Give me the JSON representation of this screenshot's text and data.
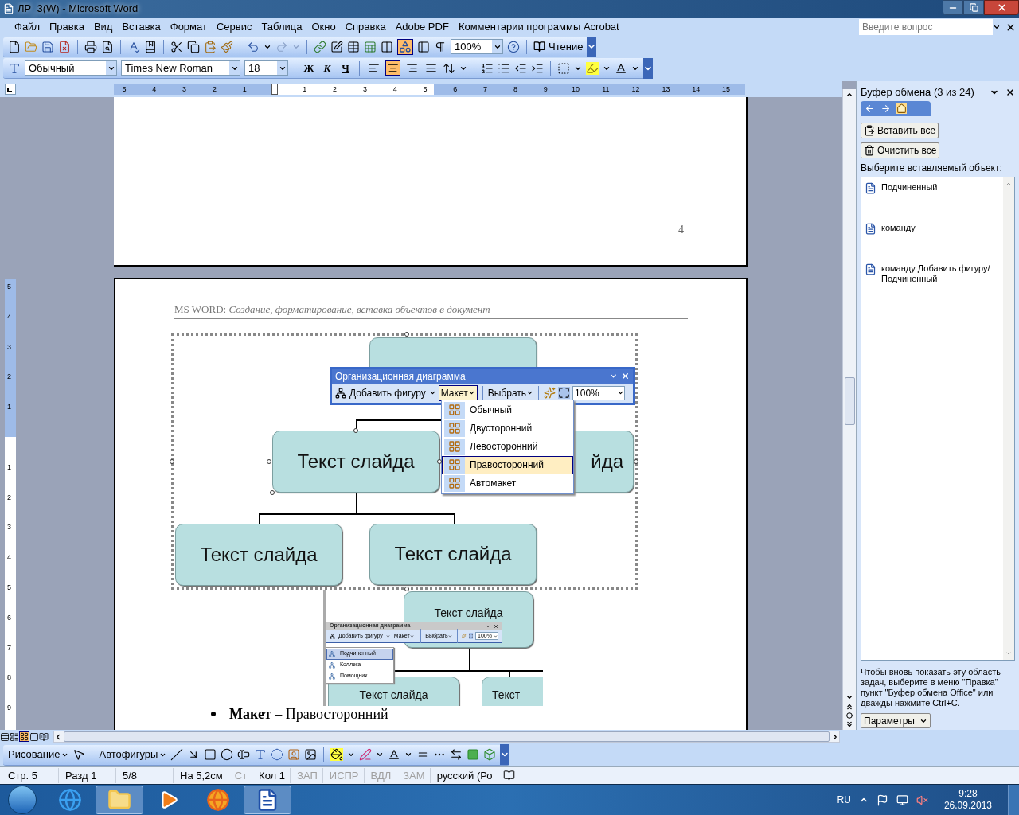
{
  "window": {
    "title": "ЛР_3(W) - Microsoft Word"
  },
  "menu": [
    {
      "label": "Файл"
    },
    {
      "label": "Правка"
    },
    {
      "label": "Вид"
    },
    {
      "label": "Вставка"
    },
    {
      "label": "Формат"
    },
    {
      "label": "Сервис"
    },
    {
      "label": "Таблица"
    },
    {
      "label": "Окно"
    },
    {
      "label": "Справка"
    },
    {
      "label": "Adobe PDF"
    },
    {
      "label": "Комментарии программы Acrobat"
    }
  ],
  "help_field": {
    "placeholder": "Введите вопрос"
  },
  "standard_toolbar": {
    "drawing_selected": true,
    "zoom": "100%",
    "reading": "Чтение"
  },
  "formatting_toolbar": {
    "style": "Обычный",
    "font": "Times New Roman",
    "size": "18",
    "text_buttons": [
      {
        "label": "Ж",
        "kind": "bold"
      },
      {
        "label": "К",
        "kind": "italic"
      },
      {
        "label": "Ч",
        "kind": "underline"
      }
    ],
    "alignment": [
      {
        "kind": "left",
        "selected": false
      },
      {
        "kind": "center",
        "selected": true
      },
      {
        "kind": "right",
        "selected": false
      },
      {
        "kind": "justify",
        "selected": false
      }
    ]
  },
  "horizontal_ruler": {
    "left_numbers": [
      "5",
      "4",
      "3",
      "2",
      "1"
    ],
    "right_numbers": [
      "1",
      "2",
      "3",
      "4",
      "5",
      "6",
      "7",
      "8",
      "9",
      "10",
      "11",
      "12",
      "13",
      "14",
      "15"
    ]
  },
  "vertical_ruler": {
    "top_numbers": [
      "5",
      "4",
      "3",
      "2",
      "1"
    ],
    "bottom_numbers": [
      "1",
      "2",
      "3",
      "4",
      "5",
      "6",
      "7",
      "8",
      "9"
    ]
  },
  "page_number": "4",
  "running_header": "MS WORD: *Создание, форматирование, вставка объектов в документ*",
  "org_chart": {
    "middle_left": "Текст слайда",
    "middle_right": "йда",
    "bottom": [
      "Текст слайда",
      "Текст слайда"
    ]
  },
  "org_toolbar": {
    "title": "Организационная диаграмма",
    "add_shape": "Добавить фигуру",
    "layout": "Макет",
    "select": "Выбрать",
    "zoom": "100%"
  },
  "layout_menu": [
    {
      "label": "Обычный",
      "selected": false
    },
    {
      "label": "Двусторонний",
      "selected": false
    },
    {
      "label": "Левосторонний",
      "selected": false
    },
    {
      "label": "Правосторонний",
      "selected": true
    },
    {
      "label": "Автомакет",
      "selected": false
    }
  ],
  "embedded_screenshot": {
    "top_node": "Текст слайда",
    "toolbar": {
      "title": "Организационная диаграмма",
      "add_shape": "Добавить фигуру",
      "layout": "Макет",
      "select": "Выбрать",
      "zoom": "100%"
    },
    "menu": [
      {
        "label": "Подчиненный",
        "selected": true
      },
      {
        "label": "Коллега",
        "selected": false
      },
      {
        "label": "Помощник",
        "selected": false
      }
    ],
    "bottom_nodes": [
      "Текст слайда",
      "Текст"
    ]
  },
  "bullet": "**Макет** – Правосторонний",
  "task_pane": {
    "title": "Буфер обмена (3 из 24)",
    "paste_all": "Вставить все",
    "clear_all": "Очистить все",
    "prompt": "Выберите вставляемый объект:",
    "items": [
      "Подчиненный",
      "команду",
      "команду Добавить фигуру/Подчиненный"
    ],
    "hint": "Чтобы вновь показать эту область задач, выберите в меню \"Правка\" пункт \"Буфер обмена Office\" или дважды нажмите Ctrl+C.",
    "options": "Параметры"
  },
  "drawing_toolbar": {
    "draw": "Рисование",
    "autoshapes": "Автофигуры"
  },
  "status_bar": [
    {
      "text": "Стр. 5",
      "disabled": false
    },
    {
      "text": "Разд 1",
      "disabled": false
    },
    {
      "text": "5/8",
      "disabled": false
    },
    {
      "text": "На 5,2см",
      "disabled": false
    },
    {
      "text": "Ст",
      "disabled": true
    },
    {
      "text": "Кол 1",
      "disabled": false
    },
    {
      "text": "ЗАП",
      "disabled": true
    },
    {
      "text": "ИСПР",
      "disabled": true
    },
    {
      "text": "ВДЛ",
      "disabled": true
    },
    {
      "text": "ЗАМ",
      "disabled": true
    },
    {
      "text": "русский (Ро",
      "disabled": false
    }
  ],
  "taskbar": {
    "apps": [
      {
        "kind": "ie",
        "running": false
      },
      {
        "kind": "explorer",
        "running": true
      },
      {
        "kind": "media",
        "running": false
      },
      {
        "kind": "firefox",
        "running": false
      },
      {
        "kind": "word",
        "running": true
      }
    ],
    "language": "RU",
    "time": "9:28",
    "date": "26.09.2013"
  }
}
